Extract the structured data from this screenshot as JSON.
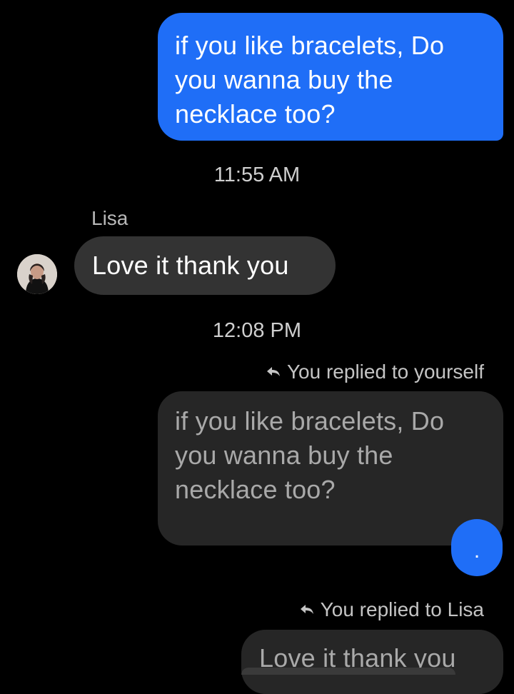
{
  "messages": {
    "outgoing_1": "if you like bracelets, Do you wanna buy the necklace too?",
    "timestamp_1": "11:55 AM",
    "sender_name": "Lisa",
    "incoming_1": "Love it thank you",
    "timestamp_2": "12:08 PM",
    "reply_note_1": "You replied to yourself",
    "quoted_1": "if you like bracelets, Do you wanna buy the necklace too?",
    "reply_text_1": ".",
    "reply_note_2": "You replied to Lisa",
    "quoted_2": "Love it thank you"
  },
  "icons": {
    "reply": "reply-arrow-icon",
    "avatar": "profile-photo"
  },
  "colors": {
    "background": "#000000",
    "outgoing_bubble": "#1f6ef7",
    "incoming_bubble": "#333333",
    "quoted_bubble": "#262626"
  }
}
